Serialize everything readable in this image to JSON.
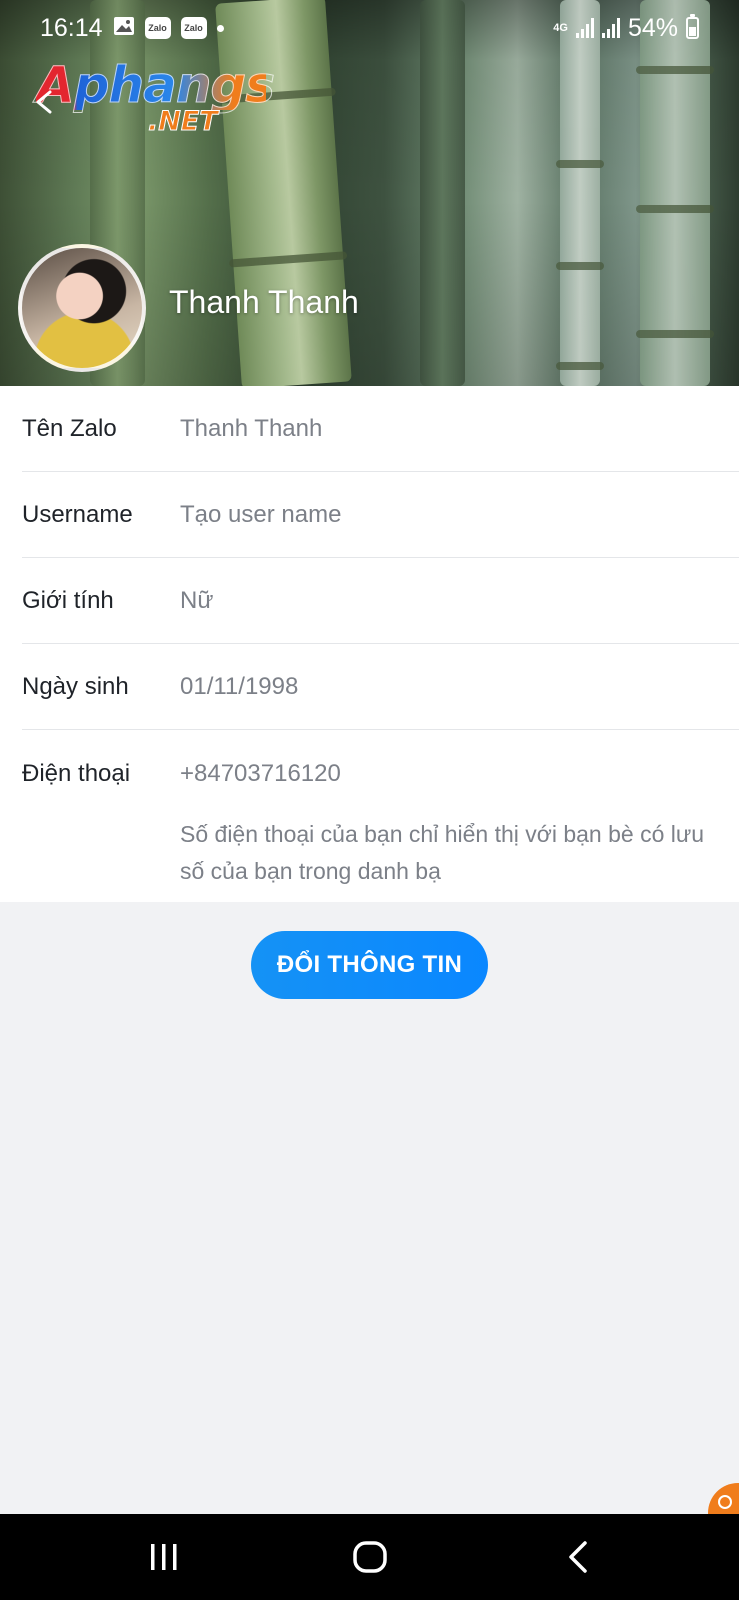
{
  "status_bar": {
    "time": "16:14",
    "notification_icons": [
      "gallery-icon",
      "zalo-icon",
      "zalo-icon"
    ],
    "zalo_label": "Zalo",
    "network": "4G",
    "battery": "54%"
  },
  "watermark": {
    "main": "Aphangs",
    "sub": ".NET"
  },
  "profile": {
    "name": "Thanh Thanh"
  },
  "info": {
    "rows": [
      {
        "label": "Tên Zalo",
        "value": "Thanh Thanh"
      },
      {
        "label": "Username",
        "value": "Tạo user name"
      },
      {
        "label": "Giới tính",
        "value": "Nữ"
      },
      {
        "label": "Ngày sinh",
        "value": "01/11/1998"
      }
    ],
    "phone": {
      "label": "Điện thoại",
      "value": "+84703716120",
      "note": "Số điện thoại của bạn chỉ hiển thị với bạn bè có lưu số của bạn trong danh bạ"
    }
  },
  "actions": {
    "edit_label": "ĐỔI THÔNG TIN"
  },
  "colors": {
    "accent": "#0a87ff",
    "background": "#f1f2f4",
    "label_text": "#1f2329",
    "value_text": "#7c8088"
  }
}
